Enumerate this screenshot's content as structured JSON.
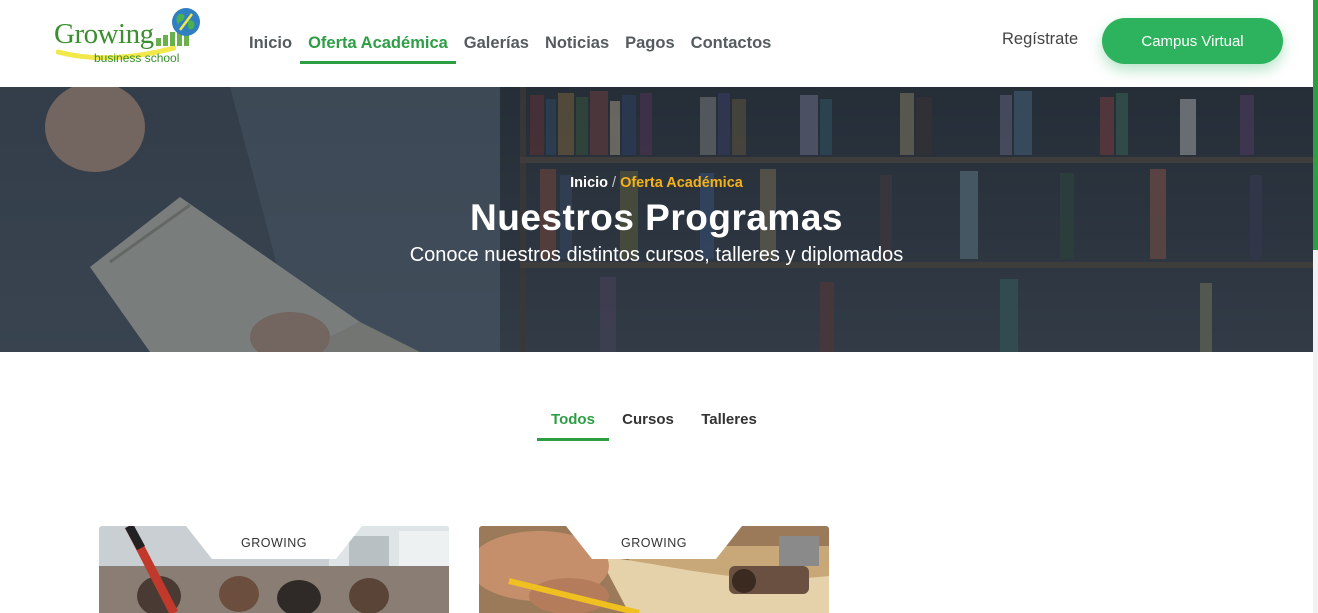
{
  "brand": {
    "name": "Growing",
    "tagline": "business school",
    "logo_icon": "globe-growth-logo",
    "color": "#3a8f2e"
  },
  "nav": {
    "items": [
      {
        "label": "Inicio",
        "active": false
      },
      {
        "label": "Oferta Académica",
        "active": true
      },
      {
        "label": "Galerías",
        "active": false
      },
      {
        "label": "Noticias",
        "active": false
      },
      {
        "label": "Pagos",
        "active": false
      },
      {
        "label": "Contactos",
        "active": false
      }
    ],
    "register_label": "Regístrate",
    "campus_button_label": "Campus Virtual"
  },
  "hero": {
    "breadcrumb": {
      "home": "Inicio",
      "separator": "/",
      "current": "Oferta Académica"
    },
    "title": "Nuestros Programas",
    "subtitle": "Conoce nuestros distintos cursos, talleres y diplomados"
  },
  "filters": {
    "tabs": [
      {
        "label": "Todos",
        "active": true
      },
      {
        "label": "Cursos",
        "active": false
      },
      {
        "label": "Talleres",
        "active": false
      }
    ]
  },
  "programs": [
    {
      "tag": "GROWING",
      "image": "classroom-photo"
    },
    {
      "tag": "GROWING",
      "image": "woodworking-photo"
    }
  ],
  "colors": {
    "accent": "#2e9e45",
    "button": "#2db35d",
    "breadcrumb_current": "#f6b21b",
    "nav_text": "#555b5e"
  }
}
